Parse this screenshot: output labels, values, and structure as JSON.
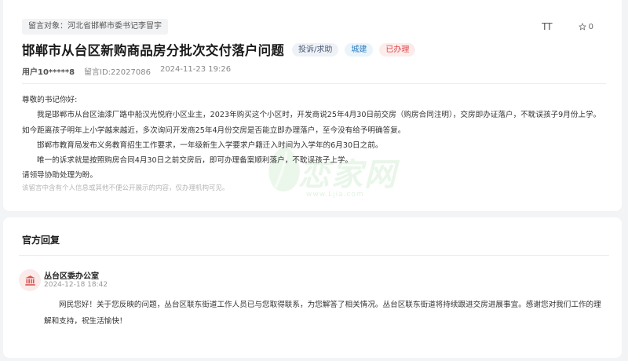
{
  "message": {
    "target_label": "留言对象：河北省邯郸市委书记李冒宇",
    "font_toggle": "TT",
    "favorite_count": "0",
    "title": "邯郸市从台区新购商品房分批次交付落户问题",
    "tags": {
      "type": "投诉/求助",
      "field": "城建",
      "status": "已办理"
    },
    "user": "用户10*****8",
    "message_id": "留言ID:22027086",
    "datetime": "2024-11-23 19:26",
    "paragraphs": [
      "尊敬的书记你好:",
      "我是邯郸市从台区油漆厂路中船汉光悦府小区业主，2023年购买这个小区时，开发商说25年4月30日前交房（购房合同注明），交房即办证落户，不耽误孩子9月份上学。如今距离孩子明年上小学越来越近，多次询问开发商25年4月份交房是否能立即办理落户，至今没有给予明确答复。",
      "邯郸市教育局发布义务教育招生工作要求，一年级新生入学要求户籍迁入时间为入学年的6月30日之前。",
      "唯一的诉求就是按照购房合同4月30日之前交房后，即可办理备案顺利落户，不耽误孩子上学。",
      "请领导协助处理为盼。"
    ],
    "privacy_note": "该留言中含有个人信息或其他不便公开展示的内容，仅办理机构可见。",
    "watermark": "恋家网",
    "watermark_url": "www.Ljia.com"
  },
  "reply": {
    "section_title": "官方回复",
    "org_name": "丛台区委办公室",
    "datetime": "2024-12-18 18:42",
    "text": "网民您好！关于您反映的问题，丛台区联东街道工作人员已与您取得联系，为您解答了相关情况。丛台区联东街道将持续跟进交房进展事宜。感谢您对我们工作的理解和支持，祝生活愉快！"
  },
  "colors": {
    "status_red": "#e04848",
    "field_blue": "#2f7cc0",
    "watermark_green": "#78c878"
  }
}
